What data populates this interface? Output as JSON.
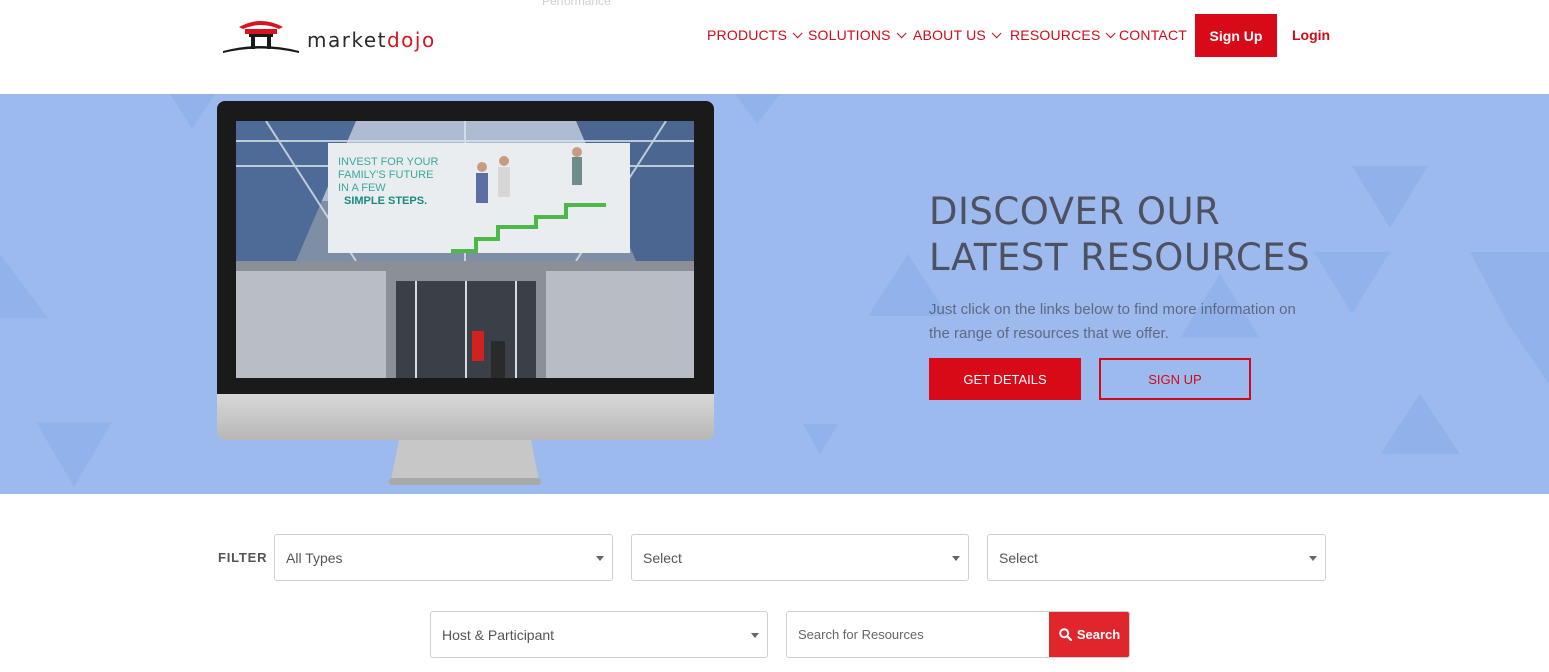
{
  "header": {
    "ghost_text": "Performance",
    "logo": {
      "text_main": "market",
      "text_accent": "dojo"
    },
    "nav": [
      {
        "label": "PRODUCTS",
        "has_dropdown": true
      },
      {
        "label": "SOLUTIONS",
        "has_dropdown": true
      },
      {
        "label": "ABOUT US",
        "has_dropdown": true
      },
      {
        "label": "RESOURCES",
        "has_dropdown": true
      },
      {
        "label": "CONTACT",
        "has_dropdown": false
      }
    ],
    "signup_label": "Sign Up",
    "login_label": "Login"
  },
  "hero": {
    "title": "DISCOVER OUR LATEST RESOURCES",
    "subtitle": "Just click on the links below to find more information on the range of resources that we offer.",
    "primary_button": "GET DETAILS",
    "secondary_button": "SIGN UP",
    "screen_image_text_line1": "INVEST FOR YOUR",
    "screen_image_text_line2": "FAMILY'S FUTURE",
    "screen_image_text_line3": "IN A FEW",
    "screen_image_text_line4": "SIMPLE STEPS."
  },
  "filter": {
    "label": "FILTER",
    "type_select": "All Types",
    "select_2": "Select",
    "select_3": "Select",
    "role_select": "Host & Participant",
    "search_placeholder": "Search for Resources",
    "search_button": "Search"
  },
  "colors": {
    "brand_red": "#d90a17",
    "hero_bg": "#9dbaee",
    "title_text": "#4d5160"
  }
}
